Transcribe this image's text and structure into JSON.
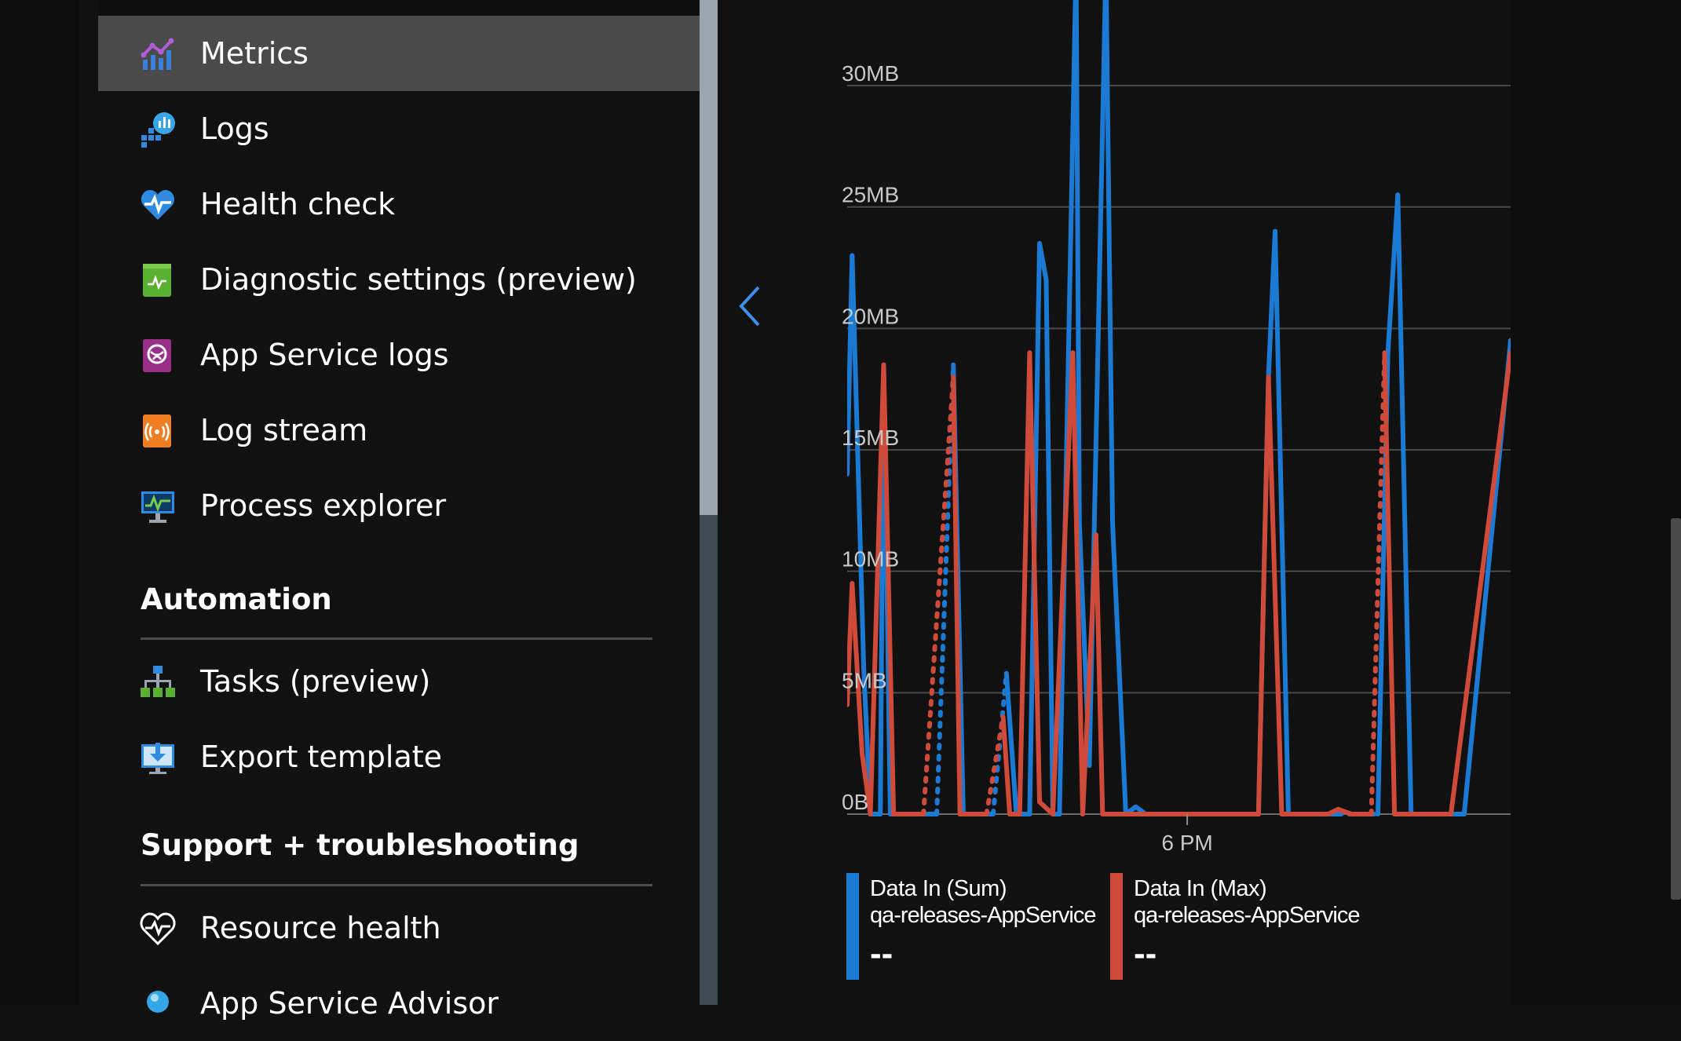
{
  "sidebar": {
    "items": [
      {
        "label": "Metrics",
        "icon": "metrics-icon",
        "active": true
      },
      {
        "label": "Logs",
        "icon": "logs-icon"
      },
      {
        "label": "Health check",
        "icon": "health-check-icon"
      },
      {
        "label": "Diagnostic settings (preview)",
        "icon": "diagnostic-settings-icon"
      },
      {
        "label": "App Service logs",
        "icon": "app-service-logs-icon"
      },
      {
        "label": "Log stream",
        "icon": "log-stream-icon"
      },
      {
        "label": "Process explorer",
        "icon": "process-explorer-icon"
      }
    ],
    "sections": [
      {
        "heading": "Automation",
        "items": [
          {
            "label": "Tasks (preview)",
            "icon": "tasks-icon"
          },
          {
            "label": "Export template",
            "icon": "export-template-icon"
          }
        ]
      },
      {
        "heading": "Support + troubleshooting",
        "items": [
          {
            "label": "Resource health",
            "icon": "resource-health-icon"
          },
          {
            "label": "App Service Advisor",
            "icon": "app-service-advisor-icon"
          }
        ]
      }
    ]
  },
  "colors": {
    "series_sum": "#1a7ad4",
    "series_max": "#d04a3a",
    "active_item_bg": "#4a4a4a",
    "background": "#111111"
  },
  "chart_data": {
    "type": "line",
    "y_tick_labels": [
      "0B",
      "5MB",
      "10MB",
      "15MB",
      "20MB",
      "25MB",
      "30MB"
    ],
    "ylim": [
      0,
      30
    ],
    "x_tick_labels": [
      {
        "label": "6 PM",
        "x": 10.25
      }
    ],
    "xlim": [
      0,
      20
    ],
    "grid": true,
    "legend_position": "bottom",
    "series": [
      {
        "name": "Data In (Sum)",
        "resource": "qa-releases-AppService",
        "value": "--",
        "color": "#1a7ad4",
        "points": [
          {
            "x": 0.0,
            "y": 14.0
          },
          {
            "x": 0.15,
            "y": 23.0
          },
          {
            "x": 0.5,
            "y": 6.0
          },
          {
            "x": 0.7,
            "y": 0
          },
          {
            "x": 1.0,
            "y": 0
          },
          {
            "x": 1.1,
            "y": 18.5
          },
          {
            "x": 1.3,
            "y": 0
          },
          {
            "x": 1.6,
            "y": 0
          },
          {
            "x": 1.9,
            "y": 0
          },
          {
            "x": 2.1,
            "y": 0
          },
          {
            "x": 2.7,
            "y": 0,
            "dashed_to_next": true
          },
          {
            "x": 3.2,
            "y": 18.5
          },
          {
            "x": 3.5,
            "y": 0
          },
          {
            "x": 4.0,
            "y": 0
          },
          {
            "x": 4.4,
            "y": 0,
            "dashed_to_next": true
          },
          {
            "x": 4.8,
            "y": 5.8
          },
          {
            "x": 5.1,
            "y": 0
          },
          {
            "x": 5.5,
            "y": 0
          },
          {
            "x": 5.8,
            "y": 23.5
          },
          {
            "x": 6.0,
            "y": 22.0
          },
          {
            "x": 6.2,
            "y": 0
          },
          {
            "x": 6.4,
            "y": 0
          },
          {
            "x": 6.9,
            "y": 35.0
          },
          {
            "x": 7.0,
            "y": 12.0
          },
          {
            "x": 7.3,
            "y": 2.0
          },
          {
            "x": 7.8,
            "y": 35.0
          },
          {
            "x": 8.0,
            "y": 12.0
          },
          {
            "x": 8.4,
            "y": 0
          },
          {
            "x": 8.7,
            "y": 0.3
          },
          {
            "x": 9.0,
            "y": 0
          },
          {
            "x": 9.6,
            "y": 0
          },
          {
            "x": 10.2,
            "y": 0
          },
          {
            "x": 10.8,
            "y": 0
          },
          {
            "x": 11.5,
            "y": 0
          },
          {
            "x": 12.1,
            "y": 0
          },
          {
            "x": 12.4,
            "y": 0
          },
          {
            "x": 12.7,
            "y": 18.0
          },
          {
            "x": 12.9,
            "y": 24.0
          },
          {
            "x": 13.3,
            "y": 0
          },
          {
            "x": 13.6,
            "y": 0
          },
          {
            "x": 14.2,
            "y": 0
          },
          {
            "x": 14.8,
            "y": 0,
            "dashed_to_next": true
          },
          {
            "x": 16.0,
            "y": 0
          },
          {
            "x": 16.3,
            "y": 19.0
          },
          {
            "x": 16.6,
            "y": 25.5
          },
          {
            "x": 17.0,
            "y": 0
          },
          {
            "x": 17.4,
            "y": 0
          },
          {
            "x": 18.0,
            "y": 0
          },
          {
            "x": 18.6,
            "y": 0
          },
          {
            "x": 20.0,
            "y": 19.5
          }
        ]
      },
      {
        "name": "Data In (Max)",
        "resource": "qa-releases-AppService",
        "value": "--",
        "color": "#d04a3a",
        "points": [
          {
            "x": 0.0,
            "y": 4.5
          },
          {
            "x": 0.15,
            "y": 9.5
          },
          {
            "x": 0.45,
            "y": 2.5
          },
          {
            "x": 0.7,
            "y": 0
          },
          {
            "x": 1.1,
            "y": 18.5
          },
          {
            "x": 1.4,
            "y": 0
          },
          {
            "x": 1.8,
            "y": 0
          },
          {
            "x": 2.1,
            "y": 0
          },
          {
            "x": 2.3,
            "y": 0,
            "dashed_to_next": true
          },
          {
            "x": 3.2,
            "y": 18.0
          },
          {
            "x": 3.4,
            "y": 0
          },
          {
            "x": 3.9,
            "y": 0
          },
          {
            "x": 4.2,
            "y": 0,
            "dashed_to_next": true
          },
          {
            "x": 4.7,
            "y": 4.0
          },
          {
            "x": 4.9,
            "y": 0
          },
          {
            "x": 5.2,
            "y": 0
          },
          {
            "x": 5.5,
            "y": 19.0
          },
          {
            "x": 5.8,
            "y": 0.5
          },
          {
            "x": 6.2,
            "y": 0
          },
          {
            "x": 6.8,
            "y": 19.0
          },
          {
            "x": 7.1,
            "y": 0
          },
          {
            "x": 7.5,
            "y": 11.5
          },
          {
            "x": 7.7,
            "y": 0
          },
          {
            "x": 8.0,
            "y": 0
          },
          {
            "x": 8.5,
            "y": 0
          },
          {
            "x": 9.0,
            "y": 0
          },
          {
            "x": 9.6,
            "y": 0
          },
          {
            "x": 10.2,
            "y": 0
          },
          {
            "x": 10.8,
            "y": 0
          },
          {
            "x": 11.5,
            "y": 0
          },
          {
            "x": 12.2,
            "y": 0
          },
          {
            "x": 12.4,
            "y": 0
          },
          {
            "x": 12.7,
            "y": 18.0
          },
          {
            "x": 13.1,
            "y": 0
          },
          {
            "x": 13.5,
            "y": 0
          },
          {
            "x": 14.1,
            "y": 0
          },
          {
            "x": 14.5,
            "y": 0
          },
          {
            "x": 14.8,
            "y": 0.2
          },
          {
            "x": 15.2,
            "y": 0
          },
          {
            "x": 15.8,
            "y": 0,
            "dashed_to_next": true
          },
          {
            "x": 16.2,
            "y": 19.0
          },
          {
            "x": 16.5,
            "y": 0
          },
          {
            "x": 17.0,
            "y": 0
          },
          {
            "x": 17.5,
            "y": 0
          },
          {
            "x": 18.2,
            "y": 0
          },
          {
            "x": 20.0,
            "y": 19.0
          }
        ]
      }
    ]
  }
}
